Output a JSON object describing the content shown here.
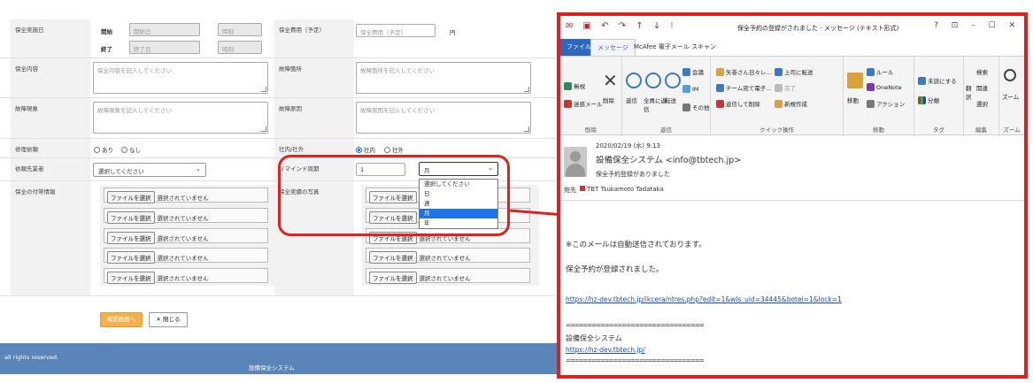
{
  "form": {
    "period_label": "保全実施日",
    "start_label": "開始",
    "end_label": "終了",
    "start_date_ph": "開始日",
    "end_date_ph": "終了日",
    "time_ph": "時刻",
    "cost_label": "保全費用（予定）",
    "cost_ph": "保全費用（予定）",
    "cost_unit": "円",
    "content_label": "保全内容",
    "content_ph": "保全内容を記入してください",
    "fault_place_label": "故障箇所",
    "fault_place_ph": "故障箇所を記入してください",
    "fault_state_label": "故障現象",
    "fault_state_ph": "故障現象を記入してください",
    "fault_cause_label": "故障原因",
    "fault_cause_ph": "故障原因を記入してください",
    "repair_label": "修理依頼",
    "repair_yes": "あり",
    "repair_no": "なし",
    "inout_label": "社内/社外",
    "inout_in": "社内",
    "inout_out": "社外",
    "vendor_label": "依頼先業者",
    "vendor_select": "選択してください",
    "reminder_label": "リマインド周期",
    "reminder_value": "1",
    "reminder_unit": "月",
    "reminder_options": [
      "選択してください",
      "日",
      "週",
      "月",
      "年"
    ],
    "reminder_selected_index": 3,
    "attach_label": "保全の付帯情報",
    "photo_label": "保全実績の写真",
    "file_btn": "ファイルを選択",
    "file_none": "選択されていません",
    "confirm_btn": "確認画面へ",
    "close_btn": "閉じる"
  },
  "footer": {
    "rights": "all rights reserved.",
    "system": "設備保全システム"
  },
  "mail": {
    "title": "保全予約の登録がされました - メッセージ (テキスト形式)",
    "window_controls": "? ⊡ – ☐ ✕",
    "tabs": [
      "ファイル",
      "メッセージ",
      "McAfee 電子メール スキャン"
    ],
    "ribbon": {
      "ignore": "無視",
      "junk": "迷惑メール",
      "delete": "削除",
      "group_delete": "削除",
      "reply": "返信",
      "reply_all": "全員に返信",
      "forward": "転送",
      "meeting": "会議",
      "im": "IM",
      "more": "その他",
      "group_reply": "返信",
      "qs1": "矢巻さん日々レ…",
      "qs2": "チーム宛て電子…",
      "qs3": "返信して削除",
      "qs4": "上司に転送",
      "qs5": "完了",
      "qs6": "新規作成",
      "group_quick": "クイック操作",
      "move": "移動",
      "rules": "ルール",
      "onenote": "OneNote",
      "actions": "アクション",
      "group_move": "移動",
      "unread": "未読にする",
      "categorize": "分類",
      "group_tags": "タグ",
      "translate": "翻訳",
      "search": "検索",
      "related": "関連",
      "select": "選択",
      "group_edit": "編集",
      "zoom": "ズーム",
      "group_zoom": "ズーム"
    },
    "date": "2020/02/19 (水) 9:13",
    "sender": "設備保全システム <info@tbtech.jp>",
    "subject": "保全予約登録がありました",
    "to_label": "宛先",
    "to_name": "TBT Tsukamoto Tadataka",
    "body_line1": "※このメールは自動送信されております。",
    "body_line2": "保全予約が登録されました。",
    "body_link": "https://hz-dev.tbtech.jp/ikcera/ntres.php?edit=1&wls_uid=34445&botei=1&lock=1",
    "separator": "================================",
    "sig_name": "設備保全システム",
    "sig_url": "https://hz-dev.tbtech.jp/"
  },
  "colors": {
    "red_highlight": "#e01f1f",
    "footer_blue": "#5b84b8",
    "confirm_orange": "#f6b04b",
    "outlook_blue": "#2e68bd"
  }
}
